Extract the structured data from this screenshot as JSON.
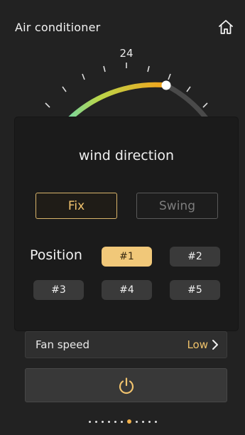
{
  "app": {
    "title": "Air conditioner"
  },
  "dial": {
    "tick_value": "24",
    "current_temp": "26",
    "minus": "−",
    "plus": "+"
  },
  "modal": {
    "title": "wind direction",
    "modes": [
      {
        "label": "Fix",
        "selected": true
      },
      {
        "label": "Swing",
        "selected": false
      }
    ],
    "position_label": "Position",
    "positions": [
      {
        "label": "#1",
        "selected": true
      },
      {
        "label": "#2",
        "selected": false
      },
      {
        "label": "#3",
        "selected": false
      },
      {
        "label": "#4",
        "selected": false
      },
      {
        "label": "#5",
        "selected": false
      }
    ]
  },
  "fan": {
    "label": "Fan speed",
    "value": "Low"
  },
  "pager": {
    "count": 11,
    "active_index": 6
  },
  "colors": {
    "accent": "#f1c879",
    "accent_text": "#efc26a",
    "background": "#222222",
    "modal": "#1b1b1b"
  },
  "icons": {
    "home": "home-icon",
    "power": "power-icon",
    "chevron": "chevron-right-icon"
  }
}
